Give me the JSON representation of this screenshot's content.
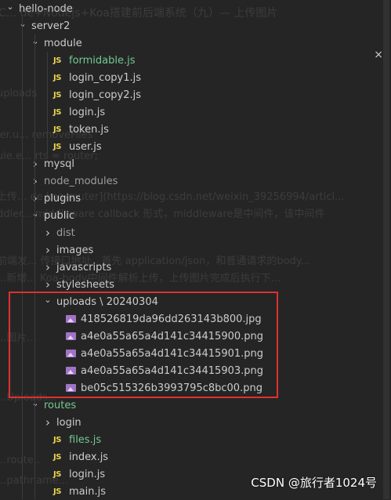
{
  "explorer": {
    "items": [
      {
        "label": "hello-node",
        "type": "folder",
        "open": true,
        "depth": 0,
        "color": "default"
      },
      {
        "label": "server2",
        "type": "folder",
        "open": true,
        "depth": 1,
        "color": "default"
      },
      {
        "label": "module",
        "type": "folder",
        "open": true,
        "depth": 2,
        "color": "default"
      },
      {
        "label": "formidable.js",
        "type": "js",
        "depth": 3,
        "color": "green"
      },
      {
        "label": "login_copy1.js",
        "type": "js",
        "depth": 3,
        "color": "default"
      },
      {
        "label": "login_copy2.js",
        "type": "js",
        "depth": 3,
        "color": "default"
      },
      {
        "label": "login.js",
        "type": "js",
        "depth": 3,
        "color": "default"
      },
      {
        "label": "token.js",
        "type": "js",
        "depth": 3,
        "color": "default"
      },
      {
        "label": "user.js",
        "type": "js",
        "depth": 3,
        "color": "default"
      },
      {
        "label": "mysql",
        "type": "folder",
        "open": false,
        "depth": 2,
        "color": "default"
      },
      {
        "label": "node_modules",
        "type": "folder",
        "open": false,
        "depth": 2,
        "color": "dim"
      },
      {
        "label": "plugins",
        "type": "folder",
        "open": false,
        "depth": 2,
        "color": "default"
      },
      {
        "label": "public",
        "type": "folder",
        "open": true,
        "depth": 2,
        "color": "default"
      },
      {
        "label": "dist",
        "type": "folder",
        "open": false,
        "depth": 3,
        "color": "dim"
      },
      {
        "label": "images",
        "type": "folder",
        "open": false,
        "depth": 3,
        "color": "default"
      },
      {
        "label": "javascripts",
        "type": "folder",
        "open": false,
        "depth": 3,
        "color": "default"
      },
      {
        "label": "stylesheets",
        "type": "folder",
        "open": false,
        "depth": 3,
        "color": "default"
      },
      {
        "label": "uploads \\ 20240304",
        "type": "folder",
        "open": true,
        "depth": 3,
        "color": "default"
      },
      {
        "label": "418526819da96dd263143b800.jpg",
        "type": "img",
        "depth": 4,
        "color": "default"
      },
      {
        "label": "a4e0a55a65a4d141c34415900.png",
        "type": "img",
        "depth": 4,
        "color": "default"
      },
      {
        "label": "a4e0a55a65a4d141c34415901.png",
        "type": "img",
        "depth": 4,
        "color": "default"
      },
      {
        "label": "a4e0a55a65a4d141c34415903.png",
        "type": "img",
        "depth": 4,
        "color": "default"
      },
      {
        "label": "be05c515326b3993795c8bc00.png",
        "type": "img",
        "depth": 4,
        "color": "default"
      },
      {
        "label": "routes",
        "type": "folder",
        "open": true,
        "depth": 2,
        "color": "green"
      },
      {
        "label": "login",
        "type": "folder",
        "open": false,
        "depth": 3,
        "color": "default"
      },
      {
        "label": "files.js",
        "type": "js",
        "depth": 3,
        "color": "green"
      },
      {
        "label": "index.js",
        "type": "js",
        "depth": 3,
        "color": "default"
      },
      {
        "label": "login.js",
        "type": "js",
        "depth": 3,
        "color": "default"
      },
      {
        "label": "main.js",
        "type": "js",
        "depth": 3,
        "color": "default"
      }
    ]
  },
  "ghost_text": [
    "C... de+Nodejs+Koa搭建前后端系统（九）— 上传图片",
    "uploads",
    "ler.u...              removeFiles",
    "ule.e...  rts = router;",
    "上传... de.koa-router](https://blog.csdn.net/weixin_39256994/articl...",
    "ddler...  middleware callback 形式，middleware是中间件，该中间件",
    "前端发... 传接口地址，首先 application/json，和普通请求的body...",
    "...新增... Koa-body中间件解析上传，上传图片完成后执行下...",
    "...图片...",
    "...Uploads...",
    "...route..",
    "...pathname..."
  ],
  "colors": {
    "background": "#252526",
    "text": "#cccccc",
    "green": "#73c991",
    "js_icon": "#e8d44d",
    "image_icon": "#a074c4",
    "highlight_box": "#e03030"
  },
  "close_glyph": "×",
  "watermark": "CSDN @旅行者1024号"
}
